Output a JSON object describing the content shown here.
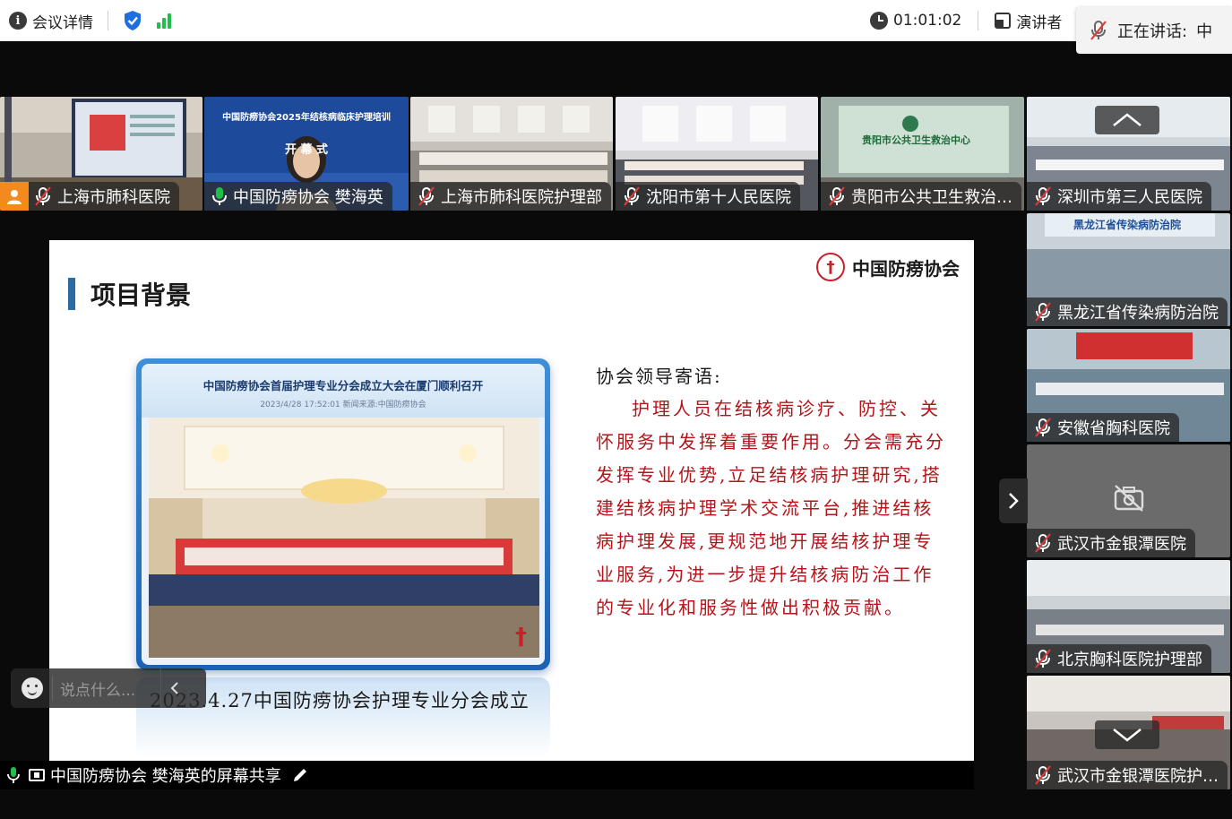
{
  "topbar": {
    "meeting_details": "会议详情",
    "timer": "01:01:02",
    "presenter_view": "演讲者"
  },
  "speaking": {
    "label": "正在讲话:",
    "name": "中"
  },
  "participants_top": [
    {
      "name": "上海市肺科医院",
      "mic": "off"
    },
    {
      "name": "中国防痨协会 樊海英",
      "mic": "on"
    },
    {
      "name": "上海市肺科医院护理部",
      "mic": "off"
    },
    {
      "name": "沈阳市第十人民医院",
      "mic": "off"
    },
    {
      "name": "贵阳市公共卫生救治…",
      "mic": "off"
    }
  ],
  "participants_side": [
    {
      "name": "深圳市第三人民医院",
      "mic": "off"
    },
    {
      "name": "黑龙江省传染病防治院",
      "mic": "off"
    },
    {
      "name": "安徽省胸科医院",
      "mic": "off"
    },
    {
      "name": "武汉市金银潭医院",
      "mic": "off"
    },
    {
      "name": "北京胸科医院护理部",
      "mic": "off"
    },
    {
      "name": "武汉市金银潭医院护…",
      "mic": "off"
    }
  ],
  "tile_texts": {
    "speaker_banner": "中国防痨协会2025年结核病临床护理培训",
    "speaker_banner_sub": "开 幕 式",
    "guiyang_sign": "贵阳市公共卫生救治中心",
    "heilongjiang_sign": "黑龙江省传染病防治院"
  },
  "slide": {
    "title": "项目背景",
    "brand": "中国防痨协会",
    "photo_title": "中国防痨协会首届护理专业分会成立大会在厦门顺利召开",
    "photo_sub": "2023/4/28 17:52:01  新闻来源:中国防痨协会",
    "caption": "2023.4.27中国防痨协会护理专业分会成立",
    "quote_head": "协会领导寄语:",
    "quote_body": "护理人员在结核病诊疗、防控、关怀服务中发挥着重要作用。分会需充分发挥专业优势,立足结核病护理研究,搭建结核病护理学术交流平台,推进结核病护理发展,更规范地开展结核护理专业服务,为进一步提升结核病防治工作的专业化和服务性做出积极贡献。"
  },
  "chat": {
    "placeholder": "说点什么..."
  },
  "share_bar": {
    "label": "中国防痨协会 樊海英的屏幕共享"
  },
  "colors": {
    "active_speaker": "#1fbf4a",
    "quote_red": "#b4141a",
    "title_bar": "#2c6ba2",
    "brand_red": "#c8202a"
  }
}
